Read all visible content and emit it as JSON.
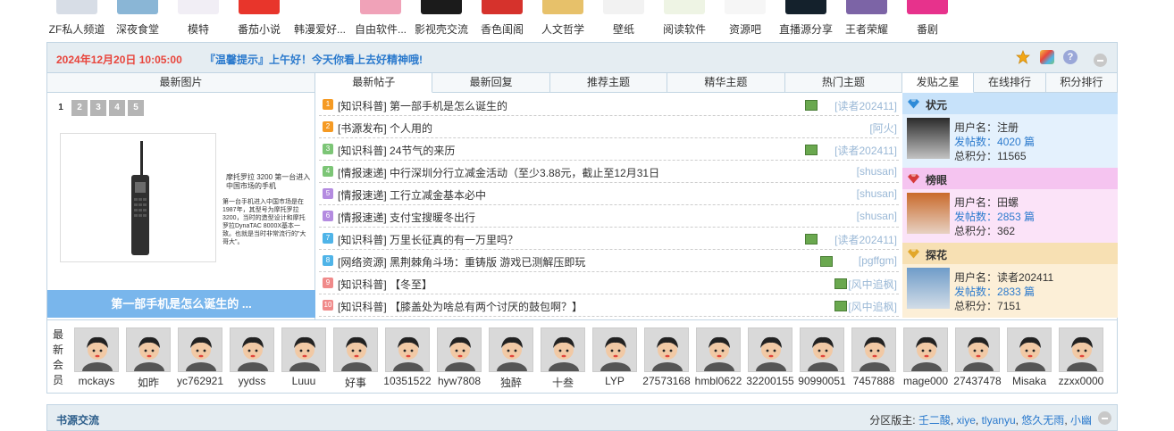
{
  "toplinks": [
    {
      "label": "ZF私人频道",
      "color": "#d7dde6"
    },
    {
      "label": "深夜食堂",
      "color": "#8ab6d6"
    },
    {
      "label": "模特",
      "color": "#f1eef5"
    },
    {
      "label": "番茄小说",
      "color": "#e8352b"
    },
    {
      "label": "韩漫爱好...",
      "color": "#ffffff"
    },
    {
      "label": "自由软件...",
      "color": "#f0a2b8"
    },
    {
      "label": "影视壳交流",
      "color": "#1b1b1b"
    },
    {
      "label": "香色闺阁",
      "color": "#d6322c"
    },
    {
      "label": "人文哲学",
      "color": "#e7c16a"
    },
    {
      "label": "壁纸",
      "color": "#f2f2f2"
    },
    {
      "label": "阅读软件",
      "color": "#eef4e4"
    },
    {
      "label": "资源吧",
      "color": "#f6f6f6"
    },
    {
      "label": "直播源分享",
      "color": "#14212c"
    },
    {
      "label": "王者荣耀",
      "color": "#7c64a6"
    },
    {
      "label": "番剧",
      "color": "#e7328c"
    }
  ],
  "welcome": {
    "date": "2024年12月20日 10:05:00",
    "tip": "『温馨提示』上午好！今天你看上去好精神哦!"
  },
  "picture_tab": "最新图片",
  "tabs": [
    "最新帖子",
    "最新回复",
    "推荐主题",
    "精华主题",
    "热门主题"
  ],
  "right_tabs": [
    "发贴之星",
    "在线排行",
    "积分排行"
  ],
  "pager": [
    "1",
    "2",
    "3",
    "4",
    "5"
  ],
  "slide": {
    "text1": "摩托罗拉 3200 第一台进入中国市场的手机",
    "text2": "第一台手机进入中国市场是在1987年，其型号为摩托罗拉3200，当时的造型设计和摩托罗拉DynaTAC 8000X基本一致。也就是当时非常流行的\"大哥大\"。",
    "caption": "第一部手机是怎么诞生的 ..."
  },
  "threads": [
    {
      "num": "1",
      "color": "#f59a23",
      "category": "[知识科普]",
      "title": "第一部手机是怎么诞生的",
      "author": "[读者202411]",
      "icon": true
    },
    {
      "num": "2",
      "color": "#f59a23",
      "category": "[书源发布]",
      "title": "个人用的",
      "author": "[阿火]",
      "icon": false
    },
    {
      "num": "3",
      "color": "#7cc576",
      "category": "[知识科普]",
      "title": "24节气的来历",
      "author": "[读者202411]",
      "icon": true
    },
    {
      "num": "4",
      "color": "#7cc576",
      "category": "[情报速递]",
      "title": "中行深圳分行立减金活动（至少3.88元，截止至12月31日",
      "author": "[shusan]",
      "icon": false
    },
    {
      "num": "5",
      "color": "#b48be0",
      "category": "[情报速递]",
      "title": "工行立减金基本必中",
      "author": "[shusan]",
      "icon": false
    },
    {
      "num": "6",
      "color": "#b48be0",
      "category": "[情报速递]",
      "title": "支付宝搜暖冬出行",
      "author": "[shusan]",
      "icon": false
    },
    {
      "num": "7",
      "color": "#4fb4e8",
      "category": "[知识科普]",
      "title": "万里长征真的有一万里吗？",
      "author": "[读者202411]",
      "icon": true
    },
    {
      "num": "8",
      "color": "#4fb4e8",
      "category": "[网络资源]",
      "title": "黑荆棘角斗场：重铸版 游戏已测解压即玩",
      "author": "[pgffgm]",
      "icon": true
    },
    {
      "num": "9",
      "color": "#f08a8a",
      "category": "[知识科普]",
      "title": "【冬至】",
      "author": "[风中追枫]",
      "icon": true
    },
    {
      "num": "10",
      "color": "#f08a8a",
      "category": "[知识科普]",
      "title": "【膝盖处为啥总有两个讨厌的鼓包啊？】",
      "author": "[风中追枫]",
      "icon": true
    }
  ],
  "ranks": [
    {
      "title": "状元",
      "head_bg": "#c7e2fa",
      "body_bg": "#e4f1fd",
      "gem": "#2e8bd8",
      "user_label": "用户名：",
      "user": "注册",
      "posts_label": "发帖数：",
      "posts": "4020 篇",
      "score_label": "总积分：",
      "score": "11565",
      "avatar": "#2b2b2b"
    },
    {
      "title": "榜眼",
      "head_bg": "#f5c4f0",
      "body_bg": "#fbe3f8",
      "gem": "#d63a3a",
      "user_label": "用户名：",
      "user": "田螺",
      "posts_label": "发帖数：",
      "posts": "2853 篇",
      "score_label": "总积分：",
      "score": "362",
      "avatar": "#c96a2b"
    },
    {
      "title": "探花",
      "head_bg": "#f7e0b3",
      "body_bg": "#fcefd7",
      "gem": "#e2a72a",
      "user_label": "用户名：",
      "user": "读者202411",
      "posts_label": "发帖数：",
      "posts": "2833 篇",
      "score_label": "总积分：",
      "score": "7151",
      "avatar": "#6f9cc9"
    }
  ],
  "members_label": "最新会员",
  "members": [
    "mckays",
    "如昨",
    "yc762921",
    "yydss",
    "Luuu",
    "好事",
    "10351522",
    "hyw7808",
    "独醉",
    "十叁",
    "LYP",
    "27573168",
    "hmbl0622",
    "32200155",
    "90990051",
    "7457888",
    "mage000",
    "27437478",
    "Misaka",
    "zzxx0000"
  ],
  "section": {
    "title": "书源交流",
    "mods_label": "分区版主:",
    "mods": [
      "壬二酸",
      "xiye",
      "tlyanyu",
      "悠久无雨",
      "小幽"
    ]
  }
}
